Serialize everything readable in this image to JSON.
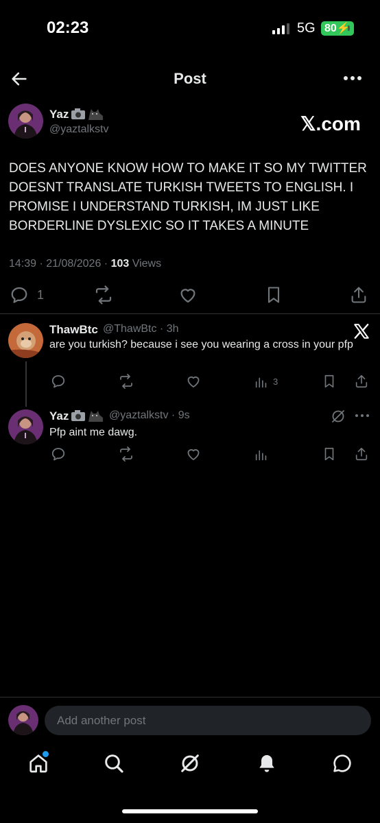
{
  "status": {
    "time": "02:23",
    "network": "5G",
    "battery": "80"
  },
  "header": {
    "title": "Post"
  },
  "post": {
    "author_name": "Yaz",
    "author_handle": "@yaztalkstv",
    "watermark": "𝕏.com",
    "text": "DOES ANYONE KNOW HOW TO MAKE IT SO MY TWITTER DOESNT TRANSLATE TURKISH TWEETS TO ENGLISH. I PROMISE I UNDERSTAND TURKISH, IM JUST LIKE BORDERLINE DYSLEXIC SO IT TAKES A MINUTE",
    "time": "14:39 · 21/08/2026 · ",
    "views_count": "103",
    "views_label": " Views",
    "reply_count": "1"
  },
  "replies": [
    {
      "name": "ThawBtc",
      "handle": "@ThawBtc · 3h",
      "text": "are you turkish? because i see you wearing a cross in your pfp",
      "views": "3"
    },
    {
      "name": "Yaz",
      "handle": "@yaztalkstv · 9s",
      "text": "Pfp aint me dawg."
    }
  ],
  "compose": {
    "placeholder": "Add another post"
  },
  "icons": {
    "back": "arrow-left-icon",
    "more": "more-dots-icon",
    "reply": "reply-icon",
    "repost": "repost-icon",
    "like": "heart-icon",
    "bookmark": "bookmark-icon",
    "share": "share-icon",
    "views": "views-icon",
    "grok": "grok-icon",
    "home": "home-icon",
    "search": "search-icon",
    "bell": "bell-icon",
    "messages": "messages-icon"
  },
  "colors": {
    "background": "#000000",
    "text": "#e7e9ea",
    "muted": "#71767b",
    "accent": "#1d9bf0",
    "battery": "#32c75a"
  }
}
